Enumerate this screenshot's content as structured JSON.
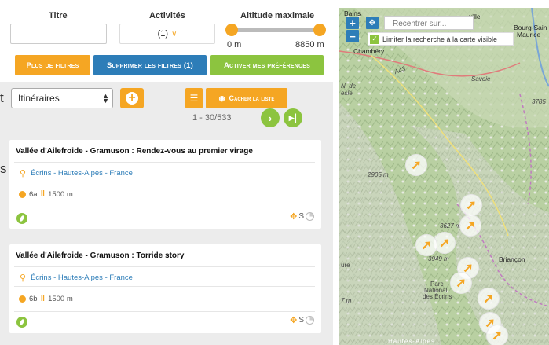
{
  "filters": {
    "titre_label": "Titre",
    "titre_value": "",
    "activites_label": "Activités",
    "activites_value": "(1)",
    "altitude_label": "Altitude maximale",
    "altitude_min": "0 m",
    "altitude_max": "8850 m"
  },
  "buttons": {
    "plus_filtres": "Plus de filtres",
    "supprimer": "Supprimer les filtres (1)",
    "activer": "Activer mes préférences",
    "cacher": "Cacher la liste"
  },
  "cut_text": {
    "top": "t",
    "side": "s"
  },
  "list": {
    "select_value": "Itinéraires",
    "pager": "1 - 30/533"
  },
  "results": [
    {
      "title": "Vallée d'Ailefroide - Gramuson : Rendez-vous au premier virage",
      "location": "Écrins - Hautes-Alpes - France",
      "grade": "6a",
      "height": "1500 m",
      "extra": "S"
    },
    {
      "title": "Vallée d'Ailefroide - Gramuson : Torride story",
      "location": "Écrins - Hautes-Alpes - France",
      "grade": "6b",
      "height": "1500 m",
      "extra": "S"
    }
  ],
  "map": {
    "recentrer_placeholder": "Recentrer sur...",
    "limit_label": "Limiter la recherche à la carte visible",
    "labels": {
      "bains": "Bains",
      "ville": "ville",
      "bourg": "Bourg-Sain",
      "maurice": "Maurice",
      "chambery": "Chambéry",
      "a43": "A43",
      "savoie": "Savoie",
      "nde": "N. de",
      "esle": "esle",
      "alt2905": "2905 m",
      "alt3627": "3627 m",
      "alt3949": "3949 m",
      "alt3785": "3785",
      "briancon": "Briançon",
      "parc": "Parc",
      "national": "National",
      "ecrins": "des Écrins",
      "hautes_alpes": "Hautes-Alpes",
      "ure": "ure",
      "m7": "7 m"
    }
  },
  "colors": {
    "orange": "#f5a623",
    "blue": "#2d7db8",
    "green": "#8cc43f"
  }
}
